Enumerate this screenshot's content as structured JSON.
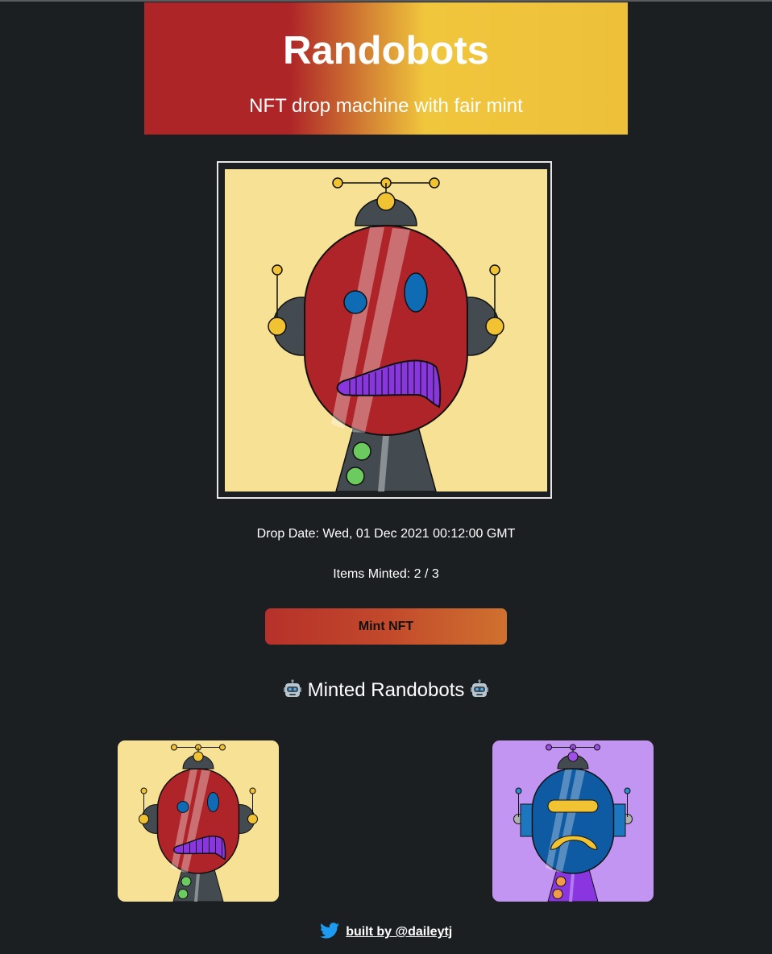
{
  "header": {
    "title": "Randobots",
    "subtitle": "NFT drop machine with fair mint"
  },
  "hero": {
    "image_icon": "robot-nft-image",
    "background_color": "#f7e195",
    "face_color": "#ae2428"
  },
  "drop": {
    "date_text": "Drop Date: Wed, 01 Dec 2021 00:12:00 GMT",
    "items_minted_text": "Items Minted: 2 / 3"
  },
  "mint_button": {
    "label": "Mint NFT"
  },
  "minted_section": {
    "title": "Minted Randobots",
    "emoji_icon": "robot-face-icon",
    "items": [
      {
        "background": "#f7e195",
        "face": "#ae2428"
      },
      {
        "background": "#c295f2",
        "face": "#0e5ba4"
      }
    ]
  },
  "footer": {
    "icon": "twitter-bird-icon",
    "link_text": "built by @daileytj"
  },
  "colors": {
    "page_background": "#1c1f22",
    "header_red": "#ae2528",
    "header_yellow": "#eec03a"
  }
}
